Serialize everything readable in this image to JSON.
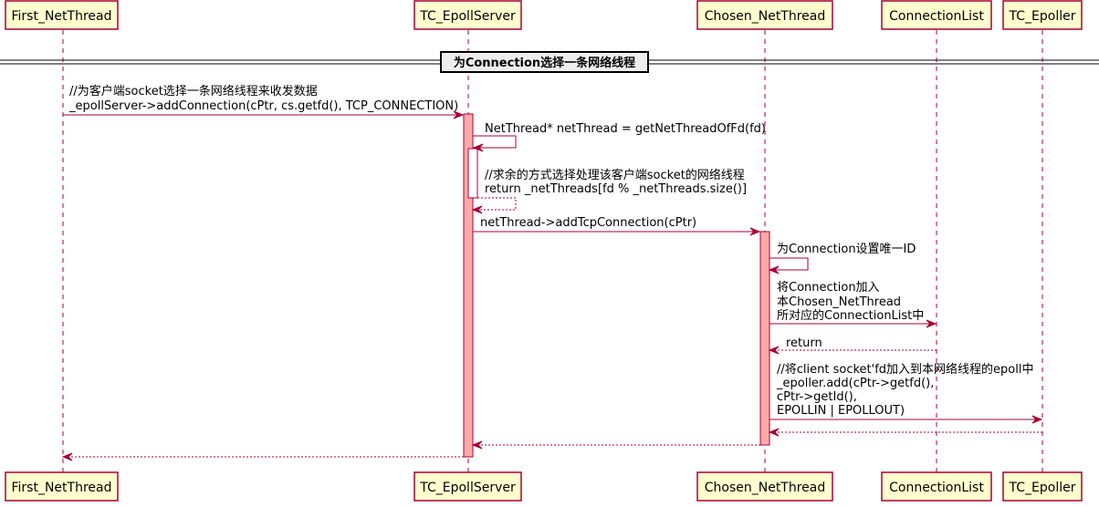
{
  "participants": [
    {
      "id": "p1",
      "label": "First_NetThread"
    },
    {
      "id": "p2",
      "label": "TC_EpollServer"
    },
    {
      "id": "p3",
      "label": "Chosen_NetThread"
    },
    {
      "id": "p4",
      "label": "ConnectionList"
    },
    {
      "id": "p5",
      "label": "TC_Epoller"
    }
  ],
  "divider": {
    "label": "为Connection选择一条网络线程"
  },
  "messages": [
    {
      "id": "m1",
      "from": "p1",
      "to": "p2",
      "style": "solid",
      "lines": [
        "//为客户端socket选择一条网络线程来收发数据",
        "_epollServer->addConnection(cPtr, cs.getfd(), TCP_CONNECTION)"
      ]
    },
    {
      "id": "m2",
      "from": "p2",
      "to": "p2",
      "style": "solid",
      "lines": [
        "NetThread* netThread = getNetThreadOfFd(fd)"
      ]
    },
    {
      "id": "m3",
      "from": "p2",
      "to": "p2",
      "style": "dashed",
      "lines": [
        "//求余的方式选择处理该客户端socket的网络线程",
        "return _netThreads[fd % _netThreads.size()]"
      ]
    },
    {
      "id": "m4",
      "from": "p2",
      "to": "p3",
      "style": "solid",
      "lines": [
        "netThread->addTcpConnection(cPtr)"
      ]
    },
    {
      "id": "m5",
      "from": "p3",
      "to": "p3",
      "style": "solid",
      "lines": [
        "为Connection设置唯一ID"
      ]
    },
    {
      "id": "m6",
      "from": "p3",
      "to": "p4",
      "style": "solid",
      "lines": [
        "将Connection加入",
        "本Chosen_NetThread",
        "所对应的ConnectionList中"
      ]
    },
    {
      "id": "m7",
      "from": "p4",
      "to": "p3",
      "style": "dashed",
      "lines": [
        "return"
      ]
    },
    {
      "id": "m8",
      "from": "p3",
      "to": "p5",
      "style": "solid",
      "lines": [
        "//将client socket'fd加入到本网络线程的epoll中",
        "_epoller.add(cPtr->getfd(),",
        "cPtr->getId(),",
        "EPOLLIN | EPOLLOUT)"
      ]
    },
    {
      "id": "m9",
      "from": "p5",
      "to": "p3",
      "style": "dashed",
      "lines": []
    },
    {
      "id": "m10",
      "from": "p3",
      "to": "p2",
      "style": "dashed",
      "lines": []
    },
    {
      "id": "m11",
      "from": "p2",
      "to": "p1",
      "style": "dashed",
      "lines": []
    }
  ],
  "colors": {
    "box_fill": "#FEFECE",
    "border": "#A80036",
    "activation": "#FFAAAA"
  }
}
